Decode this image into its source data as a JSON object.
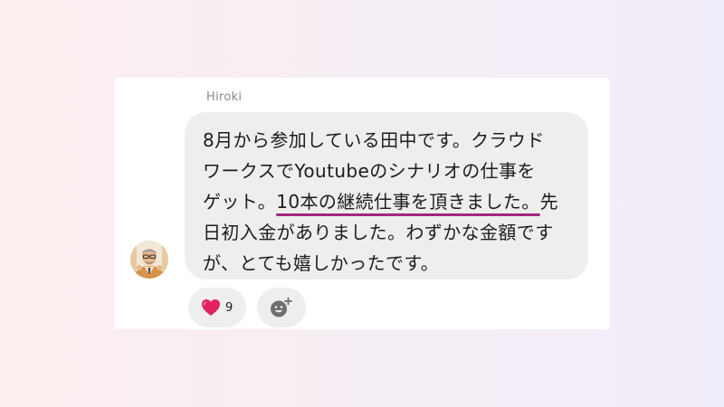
{
  "message": {
    "sender_name": "Hiroki",
    "text_lines": [
      {
        "before": "8月から参加している田中です。クラウド"
      },
      {
        "before": "ワークスでYoutubeのシナリオの仕事を"
      },
      {
        "before": "ゲット。",
        "highlight": "10本の継続仕事を頂きました。",
        "after": "先"
      },
      {
        "before": "日初入金がありました。わずかな金額です"
      },
      {
        "before": "が、とても嬉しかったです。"
      }
    ]
  },
  "reactions": [
    {
      "icon": "heart-icon",
      "count": "9"
    },
    {
      "icon": "add-reaction-icon"
    }
  ],
  "colors": {
    "bubble": "#eeeeee",
    "highlight_underline": "#a2277e",
    "heart": "#e0245e"
  }
}
